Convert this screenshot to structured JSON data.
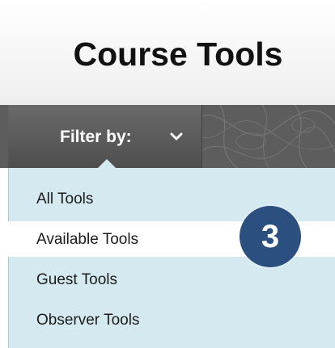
{
  "header": {
    "title": "Course Tools"
  },
  "toolbar": {
    "filter_label": "Filter by:",
    "filter_icon": "chevron-down-icon"
  },
  "menu": {
    "items": [
      {
        "label": "All Tools",
        "selected": false
      },
      {
        "label": "Available Tools",
        "selected": true
      },
      {
        "label": "Guest Tools",
        "selected": false
      },
      {
        "label": "Observer Tools",
        "selected": false
      }
    ]
  },
  "callout": {
    "number": "3"
  },
  "colors": {
    "toolbar": "#5d5d5d",
    "menu_background": "#d5e9f0",
    "selected_row": "#ffffff",
    "callout_badge": "#2b4f7e"
  }
}
